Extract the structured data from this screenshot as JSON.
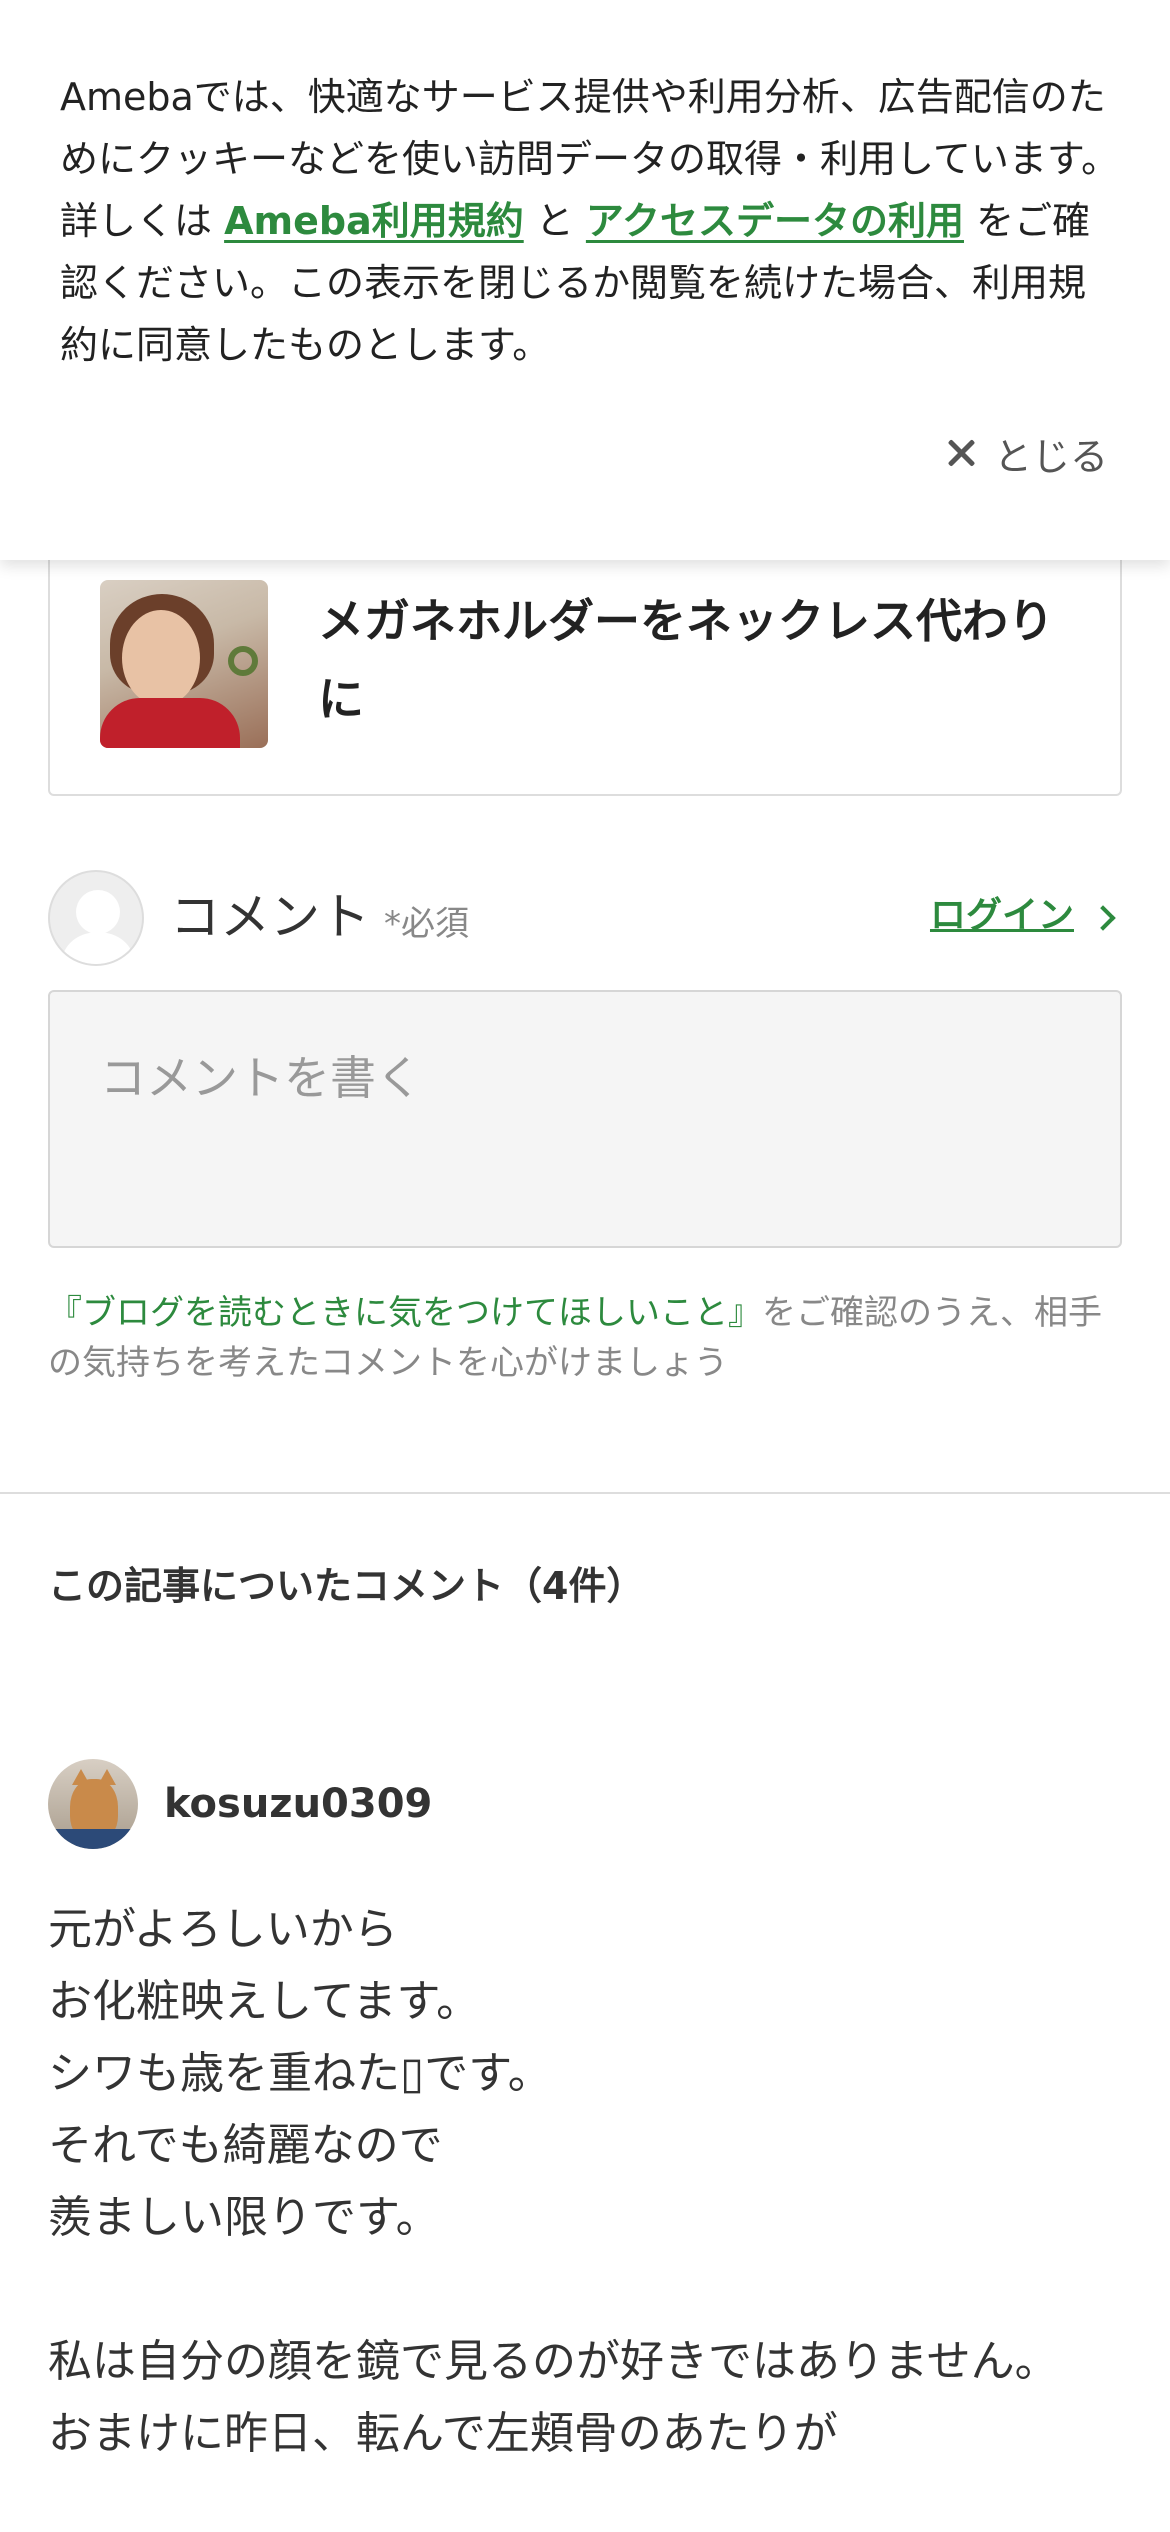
{
  "cookie_banner": {
    "text_before": "Amebaでは、快適なサービス提供や利用分析、広告配信のためにクッキーなどを使い訪問データの取得・利用しています。詳しくは ",
    "link_terms": "Ameba利用規約",
    "text_middle": " と ",
    "link_access_data": "アクセスデータの利用",
    "text_after": " をご確認ください。この表示を閉じるか閲覧を続けた場合、利用規約に同意したものとします。",
    "close_label": "とじる",
    "close_icon": "close-icon"
  },
  "article_card": {
    "title": "メガネホルダーをネックレス代わりに"
  },
  "comment_form": {
    "label": "コメント",
    "required": "*必須",
    "login_label": "ログイン",
    "placeholder": "コメントを書く",
    "guideline_link": "『ブログを読むときに気をつけてほしいこと』",
    "guideline_text": "をご確認のうえ、相手の気持ちを考えたコメントを心がけましょう"
  },
  "comments_section": {
    "heading": "この記事についたコメント（4件）",
    "items": [
      {
        "username": "kosuzu0309",
        "body": "元がよろしいから\nお化粧映えしてます。\nシワも歳を重ねた▯です。\nそれでも綺麗なので\n羨ましい限りです。\n\n私は自分の顔を鏡で見るのが好きではありません。\nおまけに昨日、転んで左頬骨のあたりが"
      }
    ]
  },
  "colors": {
    "accent_green": "#2d8a3e",
    "text_dark": "#333333",
    "text_muted": "#888888",
    "border": "#dddddd"
  }
}
